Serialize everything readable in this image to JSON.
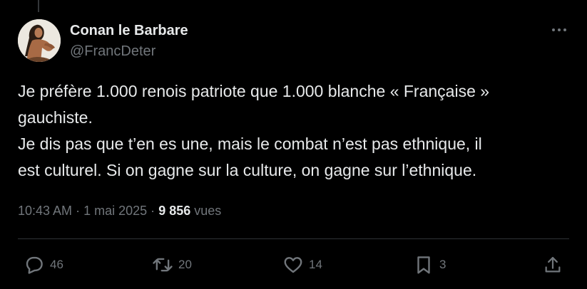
{
  "tweet": {
    "author": {
      "display_name": "Conan le Barbare",
      "handle": "@FrancDeter"
    },
    "text_lines": [
      "Je préfère 1.000 renois patriote que 1.000 blanche « Française »",
      "gauchiste.",
      "Je dis pas que t’en es une, mais le combat n’est pas ethnique, il",
      "est culturel. Si on gagne sur la culture, on gagne sur l’ethnique."
    ],
    "meta": {
      "time": "10:43 AM",
      "separator": "·",
      "date": "1 mai 2025",
      "views_count": "9 856",
      "views_label": "vues"
    },
    "actions": {
      "replies": "46",
      "reposts": "20",
      "likes": "14",
      "bookmarks": "3"
    }
  },
  "icons": {
    "more": "more-horizontal-icon",
    "reply": "speech-bubble-icon",
    "repost": "repost-arrows-icon",
    "like": "heart-icon",
    "bookmark": "bookmark-icon",
    "share": "share-upload-icon"
  },
  "colors": {
    "background": "#000000",
    "primary_text": "#e7e9ea",
    "secondary_text": "#71767b",
    "divider": "#2f3336"
  }
}
